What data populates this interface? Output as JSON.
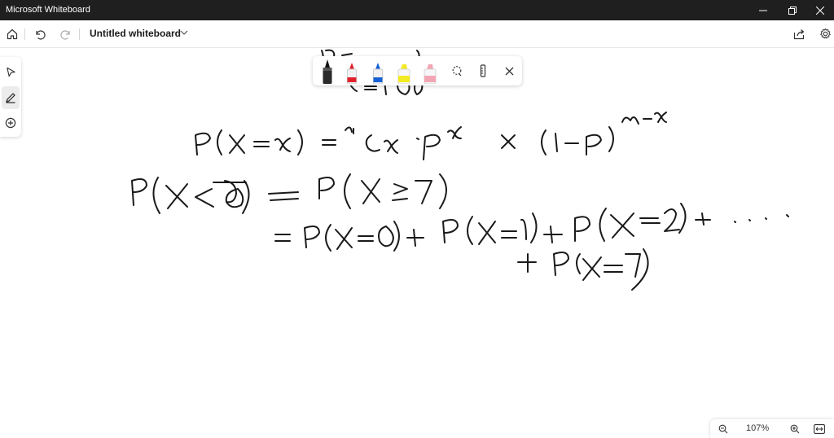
{
  "window": {
    "title": "Microsoft Whiteboard"
  },
  "toolbar": {
    "board_title": "Untitled whiteboard"
  },
  "icons": {
    "home": "home-icon",
    "undo": "undo-icon",
    "redo": "redo-icon",
    "share": "share-icon",
    "settings": "gear-icon",
    "select": "select-arrow-icon",
    "pen": "pen-icon",
    "add": "add-icon"
  },
  "pens": [
    {
      "name": "black-pen",
      "color": "#111111"
    },
    {
      "name": "red-pen",
      "color": "#e0202a"
    },
    {
      "name": "blue-pen",
      "color": "#1560d4"
    },
    {
      "name": "yellow-highlighter",
      "color": "#f2ea22"
    },
    {
      "name": "pink-highlighter",
      "color": "#f2a6b4"
    }
  ],
  "zoom": {
    "level": "107%"
  },
  "colors": {
    "titlebar": "#1f1f1f",
    "ink": "#1a1a1a",
    "canvas": "#ffffff"
  }
}
